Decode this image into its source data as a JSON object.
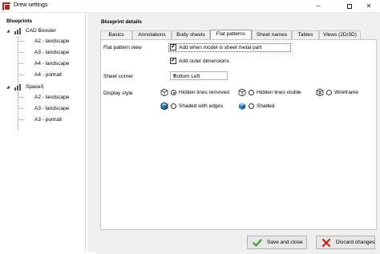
{
  "window": {
    "title": "Drew settings",
    "minimize": "─",
    "close": "✕"
  },
  "tree": {
    "root": "Blueprints",
    "groups": [
      {
        "label": "CAD Booster",
        "expanded": true,
        "items": [
          "A2 - landscape",
          "A3 - landscape",
          "A4 - landscape",
          "A4 - portrait"
        ]
      },
      {
        "label": "SpaceX",
        "expanded": true,
        "items": [
          "A2 - landscape",
          "A3 - landscape",
          "A3 - portrait"
        ]
      }
    ],
    "toggle_symbol": "◢"
  },
  "details": {
    "header": "Blueprint details",
    "tabs": [
      "Basics",
      "Annotations",
      "Body sheets",
      "Flat patterns",
      "Sheet names",
      "Tables",
      "Views (2D/3D)"
    ],
    "active_tab": "Flat patterns"
  },
  "flat_patterns": {
    "flat_pattern_view_label": "Flat pattern view",
    "add_when_sheet_metal": {
      "label": "Add when model is sheet metal part",
      "checked": true
    },
    "add_outer_dimensions": {
      "label": "Add outer dimensions",
      "checked": true
    },
    "sheet_corner_label": "Sheet corner",
    "sheet_corner_value": "Bottom Left",
    "display_style_label": "Display style",
    "display_styles": [
      {
        "label": "Hidden lines removed",
        "selected": true
      },
      {
        "label": "Hidden lines visible",
        "selected": false
      },
      {
        "label": "Wireframe",
        "selected": false
      },
      {
        "label": "Shaded with edges",
        "selected": false
      },
      {
        "label": "Shaded",
        "selected": false
      }
    ]
  },
  "actions": {
    "save_label": "Save and close",
    "discard_label": "Discard changes"
  },
  "colors": {
    "save_check": "#3aa135",
    "discard_x": "#cc2020",
    "app_icon": "#b3261e"
  }
}
